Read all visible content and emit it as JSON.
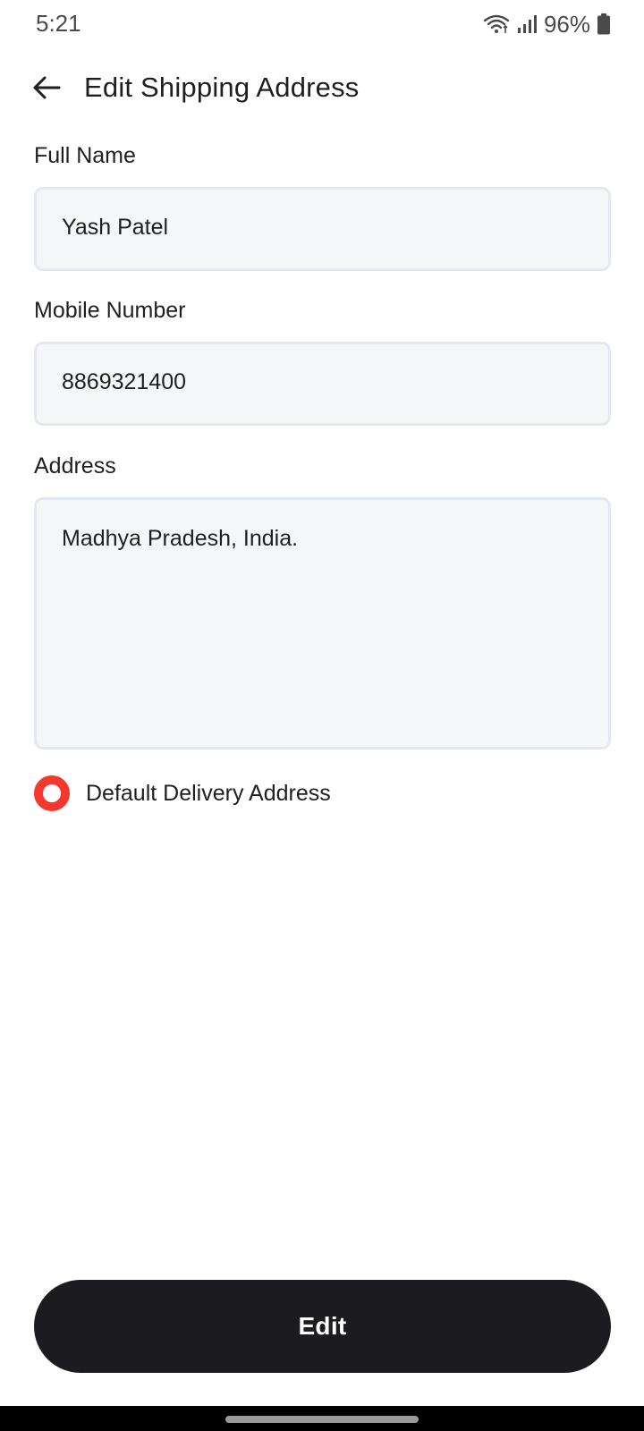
{
  "status_bar": {
    "time": "5:21",
    "battery_text": "96%",
    "icons": [
      "wifi-icon",
      "signal-icon",
      "battery-icon"
    ]
  },
  "header": {
    "back_icon": "arrow-left-icon",
    "title": "Edit Shipping Address"
  },
  "form": {
    "full_name": {
      "label": "Full Name",
      "value": "Yash Patel"
    },
    "mobile": {
      "label": "Mobile Number",
      "value": "8869321400"
    },
    "address": {
      "label": "Address",
      "value": "Madhya Pradesh, India."
    },
    "default_delivery": {
      "label": "Default Delivery Address",
      "selected": true
    }
  },
  "actions": {
    "edit_label": "Edit"
  },
  "colors": {
    "accent_red": "#f3392e",
    "button_dark": "#1c1b1f",
    "field_bg": "#f5f6f8",
    "field_border": "#e5e8ef"
  }
}
